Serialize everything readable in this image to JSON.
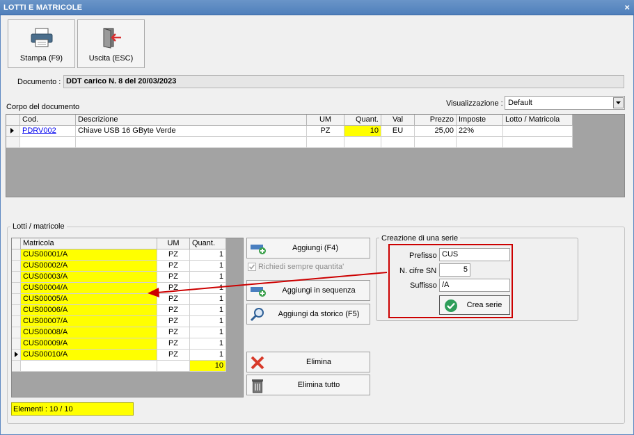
{
  "window": {
    "title": "LOTTI E MATRICOLE",
    "close_glyph": "×"
  },
  "toolbar": {
    "print_label": "Stampa (F9)",
    "print_icon": "printer-icon",
    "exit_label": "Uscita (ESC)",
    "exit_icon": "exit-door-icon"
  },
  "document": {
    "label": "Documento :",
    "value": "DDT carico N. 8 del 20/03/2023"
  },
  "body_section": {
    "title": "Corpo del documento",
    "view_label": "Visualizzazione :",
    "view_value": "Default"
  },
  "body_grid": {
    "headers": [
      "Cod.",
      "Descrizione",
      "UM",
      "Quant.",
      "Val",
      "Prezzo",
      "Imposte",
      "Lotto / Matricola"
    ],
    "rows": [
      {
        "cod": "PDRV002",
        "descrizione": "Chiave USB 16 GByte Verde",
        "um": "PZ",
        "quant": "10",
        "val": "EU",
        "prezzo": "25,00",
        "imposte": "22%",
        "lotto": ""
      }
    ]
  },
  "lots": {
    "title": "Lotti / matricole",
    "headers": [
      "Matricola",
      "UM",
      "Quant."
    ],
    "rows": [
      {
        "matricola": "CUS00001/A",
        "um": "PZ",
        "quant": "1"
      },
      {
        "matricola": "CUS00002/A",
        "um": "PZ",
        "quant": "1"
      },
      {
        "matricola": "CUS00003/A",
        "um": "PZ",
        "quant": "1"
      },
      {
        "matricola": "CUS00004/A",
        "um": "PZ",
        "quant": "1"
      },
      {
        "matricola": "CUS00005/A",
        "um": "PZ",
        "quant": "1"
      },
      {
        "matricola": "CUS00006/A",
        "um": "PZ",
        "quant": "1"
      },
      {
        "matricola": "CUS00007/A",
        "um": "PZ",
        "quant": "1"
      },
      {
        "matricola": "CUS00008/A",
        "um": "PZ",
        "quant": "1"
      },
      {
        "matricola": "CUS00009/A",
        "um": "PZ",
        "quant": "1"
      },
      {
        "matricola": "CUS00010/A",
        "um": "PZ",
        "quant": "1"
      }
    ],
    "total": "10",
    "elements_label": "Elementi : 10 / 10"
  },
  "actions": {
    "add": "Aggiungi (F4)",
    "always_ask_qty": "Richiedi sempre quantita'",
    "add_sequence": "Aggiungi in sequenza",
    "add_history": "Aggiungi da storico (F5)",
    "delete": "Elimina",
    "delete_all": "Elimina tutto"
  },
  "series": {
    "title": "Creazione di una serie",
    "prefix_label": "Prefisso",
    "prefix_value": "CUS",
    "digits_label": "N. cifre SN",
    "digits_value": "5",
    "suffix_label": "Suffisso",
    "suffix_value": "/A",
    "create_label": "Crea serie"
  },
  "colors": {
    "highlight": "#ffff00",
    "annotation": "#cc0000",
    "title_bar": "#5b89c4"
  }
}
